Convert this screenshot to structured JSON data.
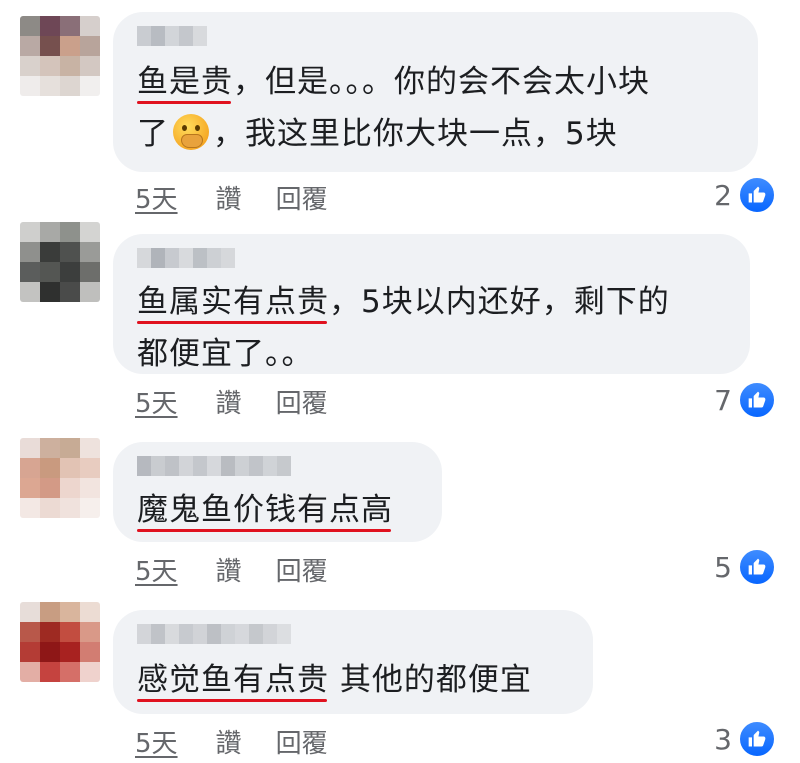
{
  "comments": [
    {
      "line1_underlined": "鱼是贵",
      "line1_rest": "，但是。。。你的会不会太小块",
      "line2_start": "了",
      "emoji": "shushing-face-emoji",
      "line2_rest": "，我这里比你大块一点，5块",
      "time": "5天",
      "like": "讚",
      "reply": "回覆",
      "reaction_count": "2"
    },
    {
      "line1_underlined": "鱼属实有点贵",
      "line1_rest": "，5块以内还好，剩下的",
      "line2": "都便宜了。。",
      "time": "5天",
      "like": "讚",
      "reply": "回覆",
      "reaction_count": "7"
    },
    {
      "line1_underlined": "魔鬼鱼价钱有点高",
      "time": "5天",
      "like": "讚",
      "reply": "回覆",
      "reaction_count": "5"
    },
    {
      "line1_underlined": "感觉鱼有点贵",
      "line1_rest": " 其他的都便宜",
      "time": "5天",
      "like": "讚",
      "reply": "回覆",
      "reaction_count": "3"
    }
  ],
  "colors": {
    "bubble": "#f0f2f5",
    "underline": "#e0121f",
    "like_blue": "#0866ff",
    "meta_text": "#65676b"
  },
  "icons": {
    "like": "thumbs-up-icon",
    "emoji": "shushing-face-emoji"
  }
}
